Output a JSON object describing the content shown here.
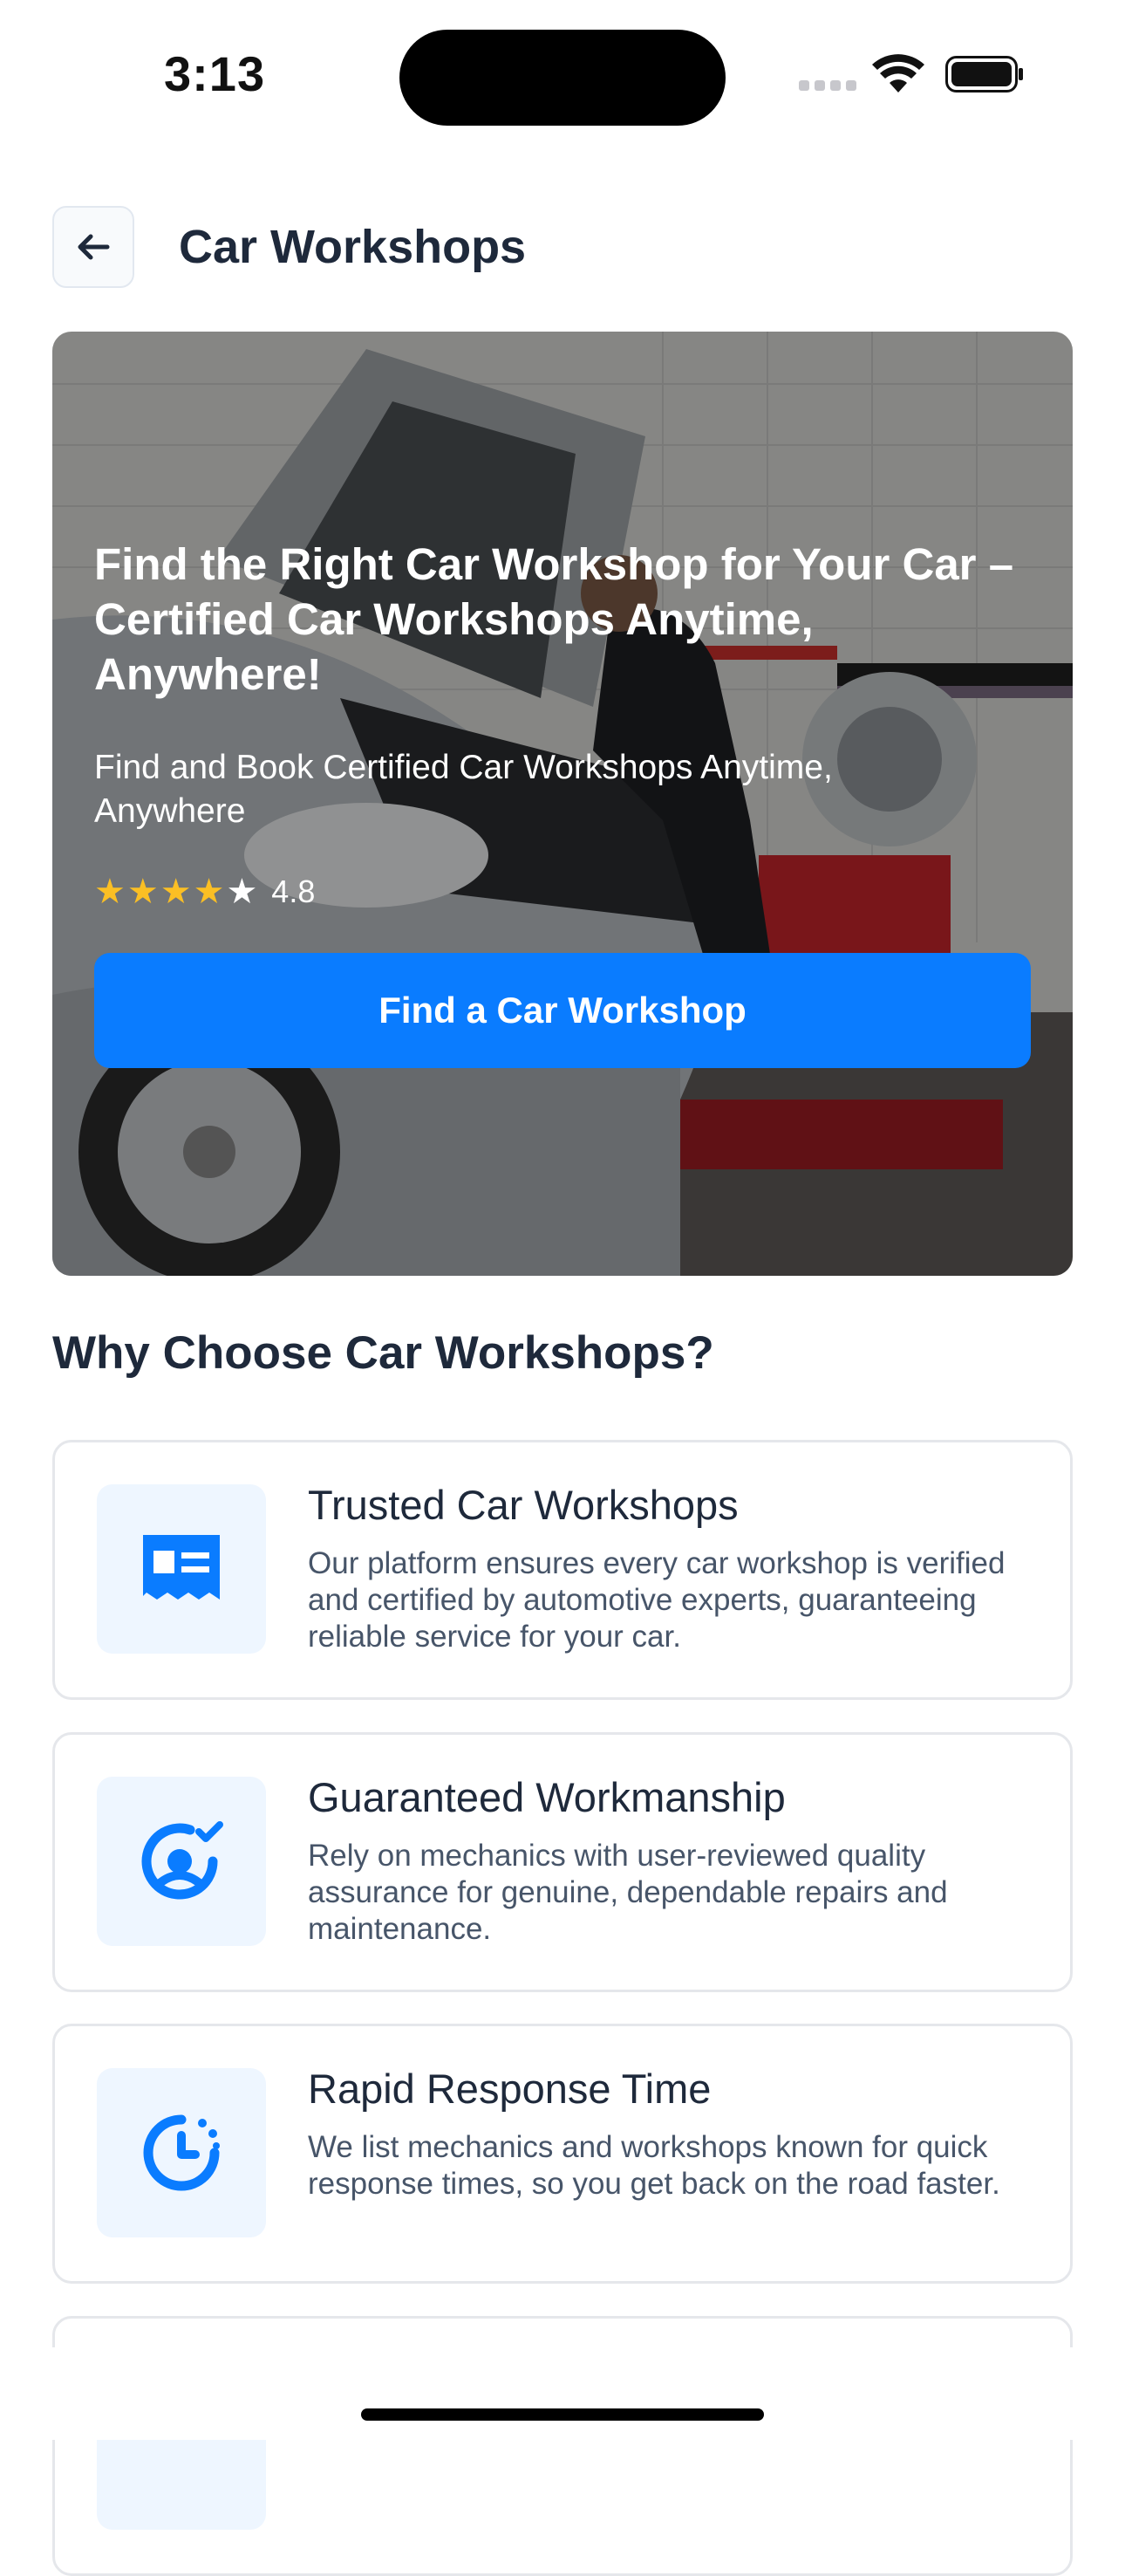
{
  "status_bar": {
    "time": "3:13"
  },
  "header": {
    "back_icon": "arrow-left-icon",
    "title": "Car Workshops"
  },
  "hero": {
    "title": "Find the Right Car Workshop for Your Car – Certified Car Workshops Anytime, Anywhere!",
    "subtitle": "Find and Book Certified Car Workshops Anytime, Anywhere",
    "rating": {
      "stars_filled": 4,
      "stars_total": 5,
      "value": "4.8"
    },
    "cta_label": "Find a Car Workshop"
  },
  "why_section": {
    "title": "Why Choose Car Workshops?",
    "cards": [
      {
        "icon": "certificate-icon",
        "title": "Trusted Car Workshops",
        "description": "Our platform ensures every car workshop is verified and certified by automotive experts, guaranteeing reliable service for your car."
      },
      {
        "icon": "verified-user-icon",
        "title": "Guaranteed Workmanship",
        "description": "Rely on mechanics with user-reviewed quality assurance for genuine, dependable repairs and maintenance."
      },
      {
        "icon": "timer-icon",
        "title": "Rapid Response Time",
        "description": "We list mechanics and workshops known for quick response times, so you get back on the road faster."
      }
    ]
  },
  "colors": {
    "accent": "#0a7cff",
    "star": "#fbbf24",
    "icon_bg": "#eef6ff"
  }
}
